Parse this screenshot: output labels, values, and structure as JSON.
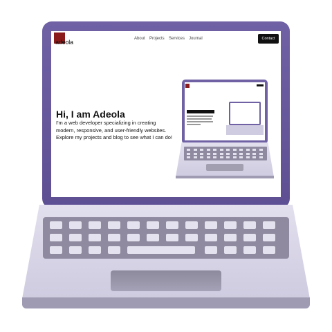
{
  "site": {
    "logo_text": "adeola",
    "nav": [
      "About",
      "Projects",
      "Services",
      "Journal"
    ],
    "contact_label": "Contact"
  },
  "hero": {
    "title": "Hi, I am Adeola",
    "body": "I'm a web developer specializing in creating modern, responsive, and user-friendly websites. Explore my projects and blog to see what I can do!"
  },
  "colors": {
    "laptop_lid": "#6f61a4",
    "laptop_body": "#d6d3e6",
    "logo": "#8b1a1a",
    "contact_button": "#111111"
  }
}
